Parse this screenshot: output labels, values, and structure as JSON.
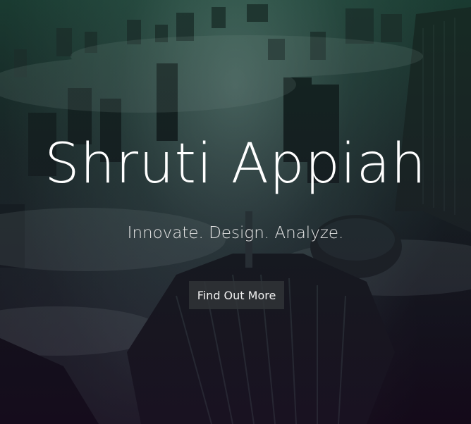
{
  "hero": {
    "title": "Shruti Appiah",
    "tagline": "Innovate. Design. Analyze.",
    "cta_label": "Find Out More"
  },
  "colors": {
    "title": "#ffffff",
    "button_background": "#303437",
    "overlay_tint": "#1e3c33"
  }
}
